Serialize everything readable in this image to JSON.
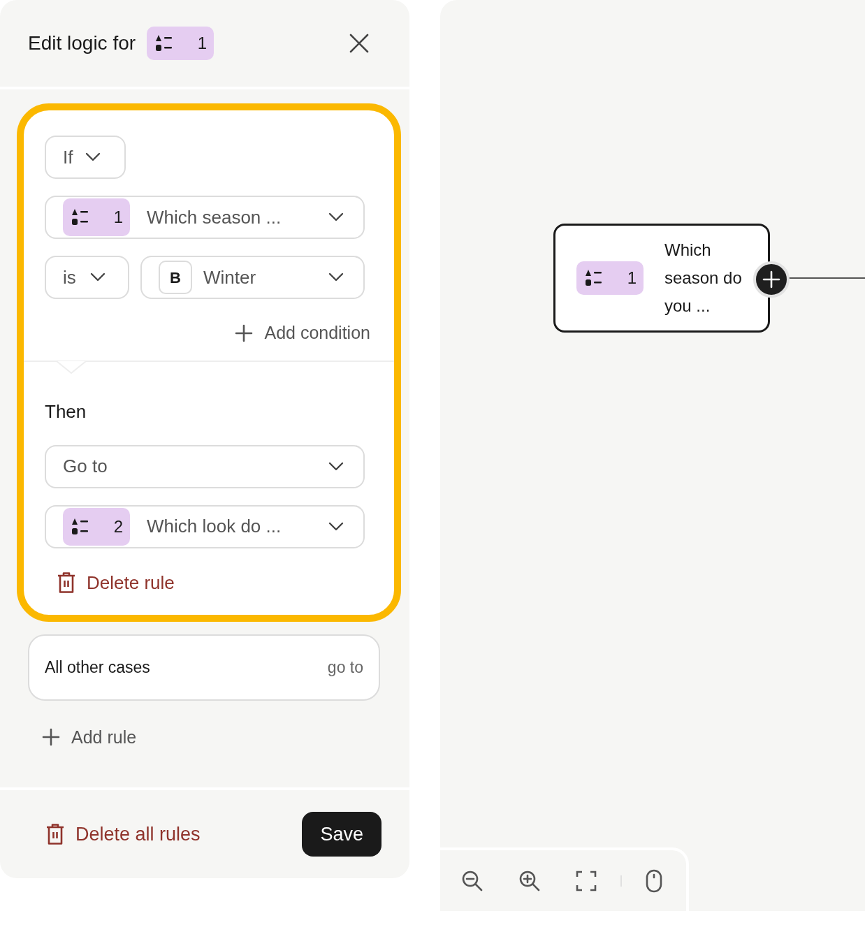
{
  "panel": {
    "title": "Edit logic for",
    "question_badge": {
      "number": "1"
    },
    "rule": {
      "highlighted": true,
      "if_dropdown": "If",
      "condition_question": {
        "number": "1",
        "text": "Which season ..."
      },
      "operator": "is",
      "answer": {
        "key": "B",
        "text": "Winter"
      },
      "add_condition": "Add condition",
      "then_label": "Then",
      "action": "Go to",
      "target_question": {
        "number": "2",
        "text": "Which look do ..."
      },
      "delete_rule": "Delete rule"
    },
    "other_cases": {
      "label": "All other cases",
      "action": "go to"
    },
    "add_rule": "Add rule",
    "delete_all": "Delete all rules",
    "save": "Save"
  },
  "canvas": {
    "node": {
      "number": "1",
      "text": "Which season do you ..."
    }
  }
}
